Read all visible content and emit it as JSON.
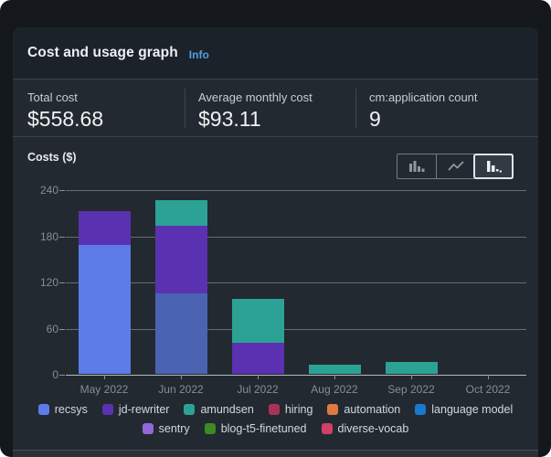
{
  "header": {
    "title": "Cost and usage graph",
    "info_label": "Info"
  },
  "stats": [
    {
      "label": "Total cost",
      "value": "$558.68"
    },
    {
      "label": "Average monthly cost",
      "value": "$93.11"
    },
    {
      "label": "cm:application count",
      "value": "9"
    }
  ],
  "chart_controls": {
    "options": [
      {
        "name": "bar-chart-view",
        "selected": false
      },
      {
        "name": "line-chart-view",
        "selected": false
      },
      {
        "name": "stacked-bar-chart-view",
        "selected": true
      }
    ]
  },
  "chart_data": {
    "type": "bar",
    "stacked": true,
    "title": "Costs ($)",
    "categories": [
      "May 2022",
      "Jun 2022",
      "Jul 2022",
      "Aug 2022",
      "Sep 2022",
      "Oct 2022"
    ],
    "series": [
      {
        "name": "recsys",
        "color": "#5d7ce7",
        "values": [
          168,
          105,
          0,
          0,
          0,
          0
        ],
        "point_colors": [
          "#5d7ce7",
          "#4a63b2",
          null,
          null,
          null,
          null
        ]
      },
      {
        "name": "jd-rewriter",
        "color": "#5a31b0",
        "values": [
          44,
          87,
          41,
          0,
          0,
          0
        ]
      },
      {
        "name": "amundsen",
        "color": "#2ca295",
        "values": [
          0,
          34,
          56,
          12,
          16,
          0
        ]
      },
      {
        "name": "hiring",
        "color": "#a93356",
        "values": [
          0,
          0,
          0,
          0,
          0,
          0
        ]
      },
      {
        "name": "automation",
        "color": "#e07a3f",
        "values": [
          0,
          0,
          0,
          0,
          0,
          0
        ]
      },
      {
        "name": "language model",
        "color": "#1a78cf",
        "values": [
          0,
          0,
          0,
          0,
          0,
          0
        ]
      },
      {
        "name": "sentry",
        "color": "#9168d8",
        "values": [
          0,
          0,
          0,
          0,
          0,
          0
        ]
      },
      {
        "name": "blog-t5-finetuned",
        "color": "#3b8a23",
        "values": [
          0,
          0,
          0,
          0,
          0,
          0
        ]
      },
      {
        "name": "diverse-vocab",
        "color": "#d13f6a",
        "values": [
          0,
          0,
          0,
          0,
          0,
          0
        ]
      }
    ],
    "ylabel": "Costs ($)",
    "ylim": [
      0,
      240
    ],
    "yticks": [
      0,
      60,
      120,
      180,
      240
    ],
    "grid": true,
    "legend_position": "bottom"
  }
}
